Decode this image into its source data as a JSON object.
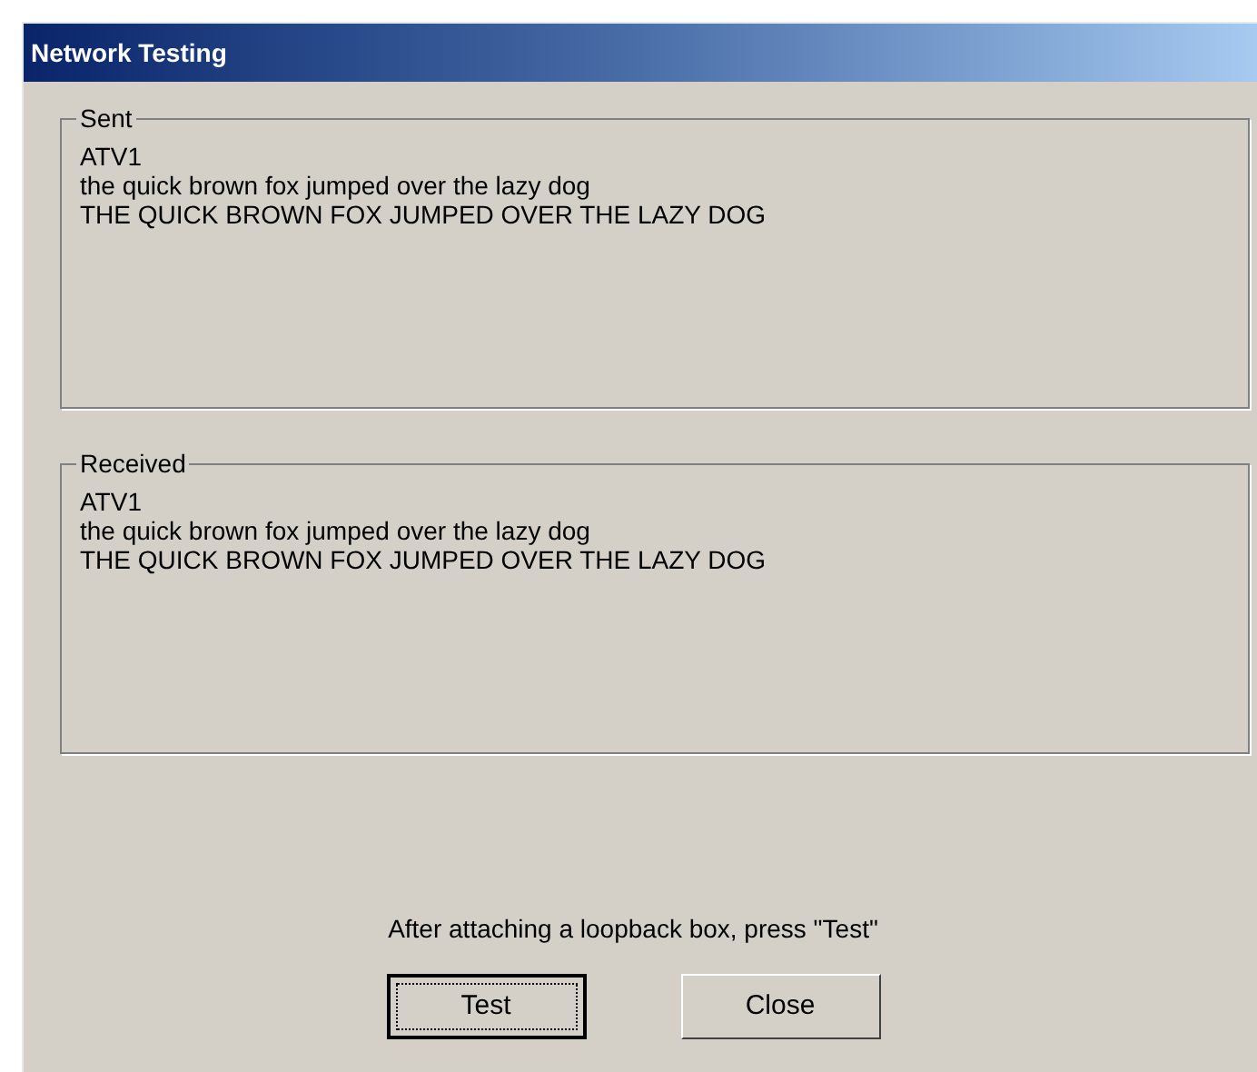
{
  "window": {
    "title": "Network Testing"
  },
  "groups": [
    {
      "label": "Sent",
      "lines": [
        "ATV1",
        "the quick brown fox jumped over the lazy dog",
        "THE QUICK BROWN FOX JUMPED OVER THE LAZY DOG"
      ]
    },
    {
      "label": "Received",
      "lines": [
        "ATV1",
        "the quick brown fox jumped over the lazy dog",
        "THE QUICK BROWN FOX JUMPED OVER THE LAZY DOG"
      ]
    }
  ],
  "instruction": "After attaching a loopback box, press \"Test\"",
  "buttons": [
    {
      "label": "Test",
      "focused": true
    },
    {
      "label": "Close",
      "focused": false
    }
  ]
}
